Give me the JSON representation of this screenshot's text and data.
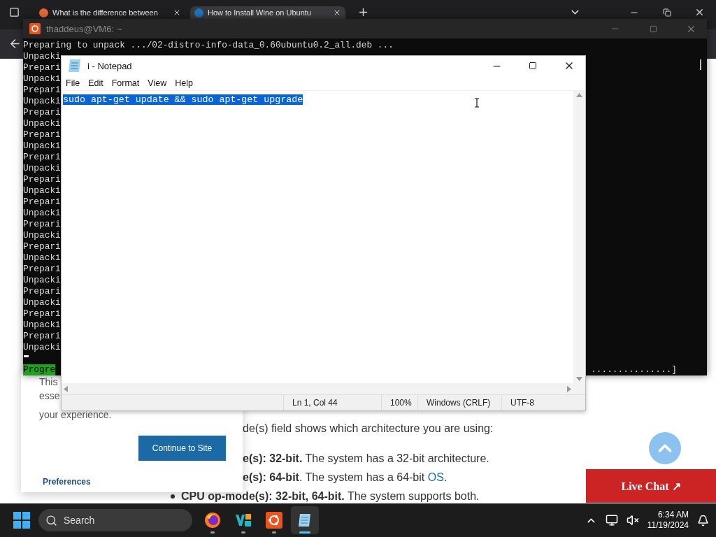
{
  "browser": {
    "tabs": [
      {
        "title": "What is the difference between",
        "selected": false
      },
      {
        "title": "How to Install Wine on Ubuntu",
        "selected": true
      }
    ]
  },
  "page": {
    "cookie_notice": {
      "lines": [
        "This",
        "esse",
        "your experience."
      ],
      "button": "Continue to Site",
      "link": "Preferences"
    },
    "article": {
      "intro": "de(s) field shows which architecture you are using:",
      "bullets": [
        {
          "bullet": false,
          "text": "**e(s): 32-bit.** The system has a 32-bit architecture."
        },
        {
          "bullet": false,
          "text": "**e(s): 64-bit**. The system has a 64-bit ",
          "link": "OS",
          "after": "."
        },
        {
          "bullet": true,
          "text": "**CPU op-mode(s): 32-bit, 64-bit.** The system supports both."
        }
      ]
    },
    "live_chat": "Live Chat ↗"
  },
  "terminal": {
    "title": "thaddeus@VM6: ~",
    "lines": [
      "Preparing to unpack .../02-distro-info-data_0.60ubuntu0.2_all.deb ...",
      "Unpacki",
      "Prepari",
      "Unpacki",
      "Prepari",
      "Unpacki",
      "Prepari",
      "Unpacki",
      "Prepari",
      "Unpacki",
      "Prepari",
      "Unpacki",
      "Prepari",
      "Unpacki",
      "Prepari",
      "Unpacki",
      "Prepari",
      "Unpacki",
      "Prepari",
      "Unpacki",
      "Prepari",
      "Unpacki",
      "Prepari",
      "Unpacki",
      "Prepari",
      "Unpacki",
      "Prepari",
      "Unpacki"
    ],
    "progress": {
      "label": "Progre",
      "bar": "...............]"
    }
  },
  "notepad": {
    "title": "i - Notepad",
    "menu": [
      "File",
      "Edit",
      "Format",
      "View",
      "Help"
    ],
    "text": "sudo apt-get update && sudo apt-get upgrade",
    "selected": true,
    "status": [
      "Ln 1, Col 44",
      "100%",
      "Windows (CRLF)",
      "UTF-8"
    ]
  },
  "taskbar": {
    "search": {
      "placeholder": "Search"
    },
    "apps": [
      {
        "kind": "firefox",
        "selected": false
      },
      {
        "kind": "editor",
        "selected": false
      },
      {
        "kind": "ubuntu",
        "selected": false
      },
      {
        "kind": "notepad",
        "selected": true
      }
    ],
    "time": "6:34 AM",
    "date": "11/19/2024"
  }
}
